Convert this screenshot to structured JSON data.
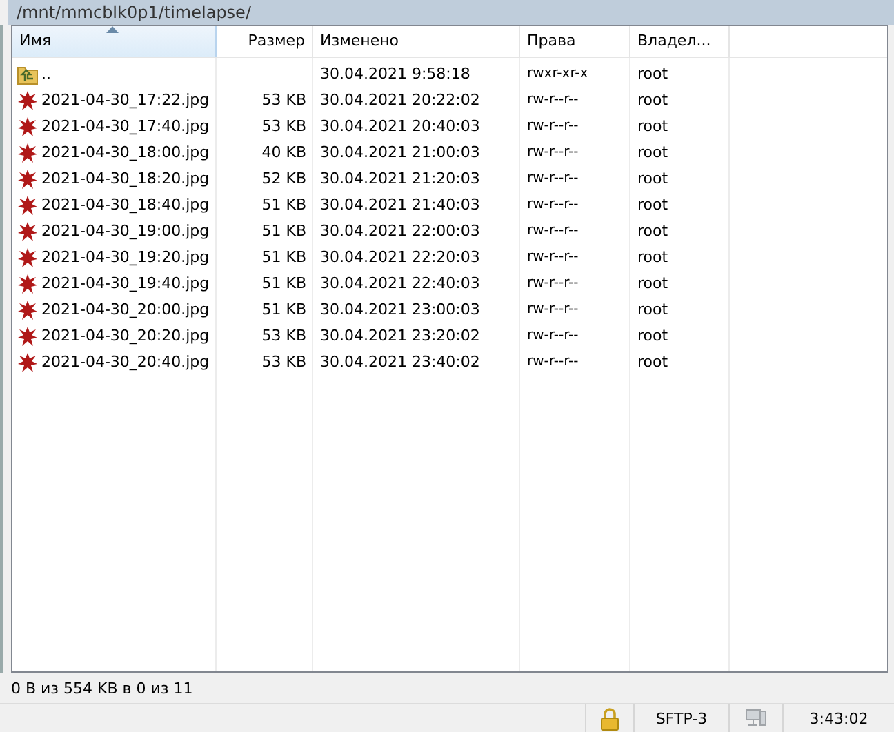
{
  "path": "/mnt/mmcblk0p1/timelapse/",
  "columns": [
    {
      "label": "Имя",
      "sorted": true
    },
    {
      "label": "Размер",
      "sorted": false
    },
    {
      "label": "Изменено",
      "sorted": false
    },
    {
      "label": "Права",
      "sorted": false
    },
    {
      "label": "Владел...",
      "sorted": false
    }
  ],
  "rows": [
    {
      "kind": "folder",
      "name": "..",
      "size": "",
      "modified": "30.04.2021 9:58:18",
      "rights": "rwxr-xr-x",
      "owner": "root"
    },
    {
      "kind": "file",
      "name": "2021-04-30_17:22.jpg",
      "size": "53 KB",
      "modified": "30.04.2021 20:22:02",
      "rights": "rw-r--r--",
      "owner": "root"
    },
    {
      "kind": "file",
      "name": "2021-04-30_17:40.jpg",
      "size": "53 KB",
      "modified": "30.04.2021 20:40:03",
      "rights": "rw-r--r--",
      "owner": "root"
    },
    {
      "kind": "file",
      "name": "2021-04-30_18:00.jpg",
      "size": "40 KB",
      "modified": "30.04.2021 21:00:03",
      "rights": "rw-r--r--",
      "owner": "root"
    },
    {
      "kind": "file",
      "name": "2021-04-30_18:20.jpg",
      "size": "52 KB",
      "modified": "30.04.2021 21:20:03",
      "rights": "rw-r--r--",
      "owner": "root"
    },
    {
      "kind": "file",
      "name": "2021-04-30_18:40.jpg",
      "size": "51 KB",
      "modified": "30.04.2021 21:40:03",
      "rights": "rw-r--r--",
      "owner": "root"
    },
    {
      "kind": "file",
      "name": "2021-04-30_19:00.jpg",
      "size": "51 KB",
      "modified": "30.04.2021 22:00:03",
      "rights": "rw-r--r--",
      "owner": "root"
    },
    {
      "kind": "file",
      "name": "2021-04-30_19:20.jpg",
      "size": "51 KB",
      "modified": "30.04.2021 22:20:03",
      "rights": "rw-r--r--",
      "owner": "root"
    },
    {
      "kind": "file",
      "name": "2021-04-30_19:40.jpg",
      "size": "51 KB",
      "modified": "30.04.2021 22:40:03",
      "rights": "rw-r--r--",
      "owner": "root"
    },
    {
      "kind": "file",
      "name": "2021-04-30_20:00.jpg",
      "size": "51 KB",
      "modified": "30.04.2021 23:00:03",
      "rights": "rw-r--r--",
      "owner": "root"
    },
    {
      "kind": "file",
      "name": "2021-04-30_20:20.jpg",
      "size": "53 KB",
      "modified": "30.04.2021 23:20:02",
      "rights": "rw-r--r--",
      "owner": "root"
    },
    {
      "kind": "file",
      "name": "2021-04-30_20:40.jpg",
      "size": "53 KB",
      "modified": "30.04.2021 23:40:02",
      "rights": "rw-r--r--",
      "owner": "root"
    }
  ],
  "selection_summary": "0 B из 554 KB в 0 из 11",
  "status_bar": {
    "protocol": "SFTP-3",
    "time": "3:43:02"
  }
}
